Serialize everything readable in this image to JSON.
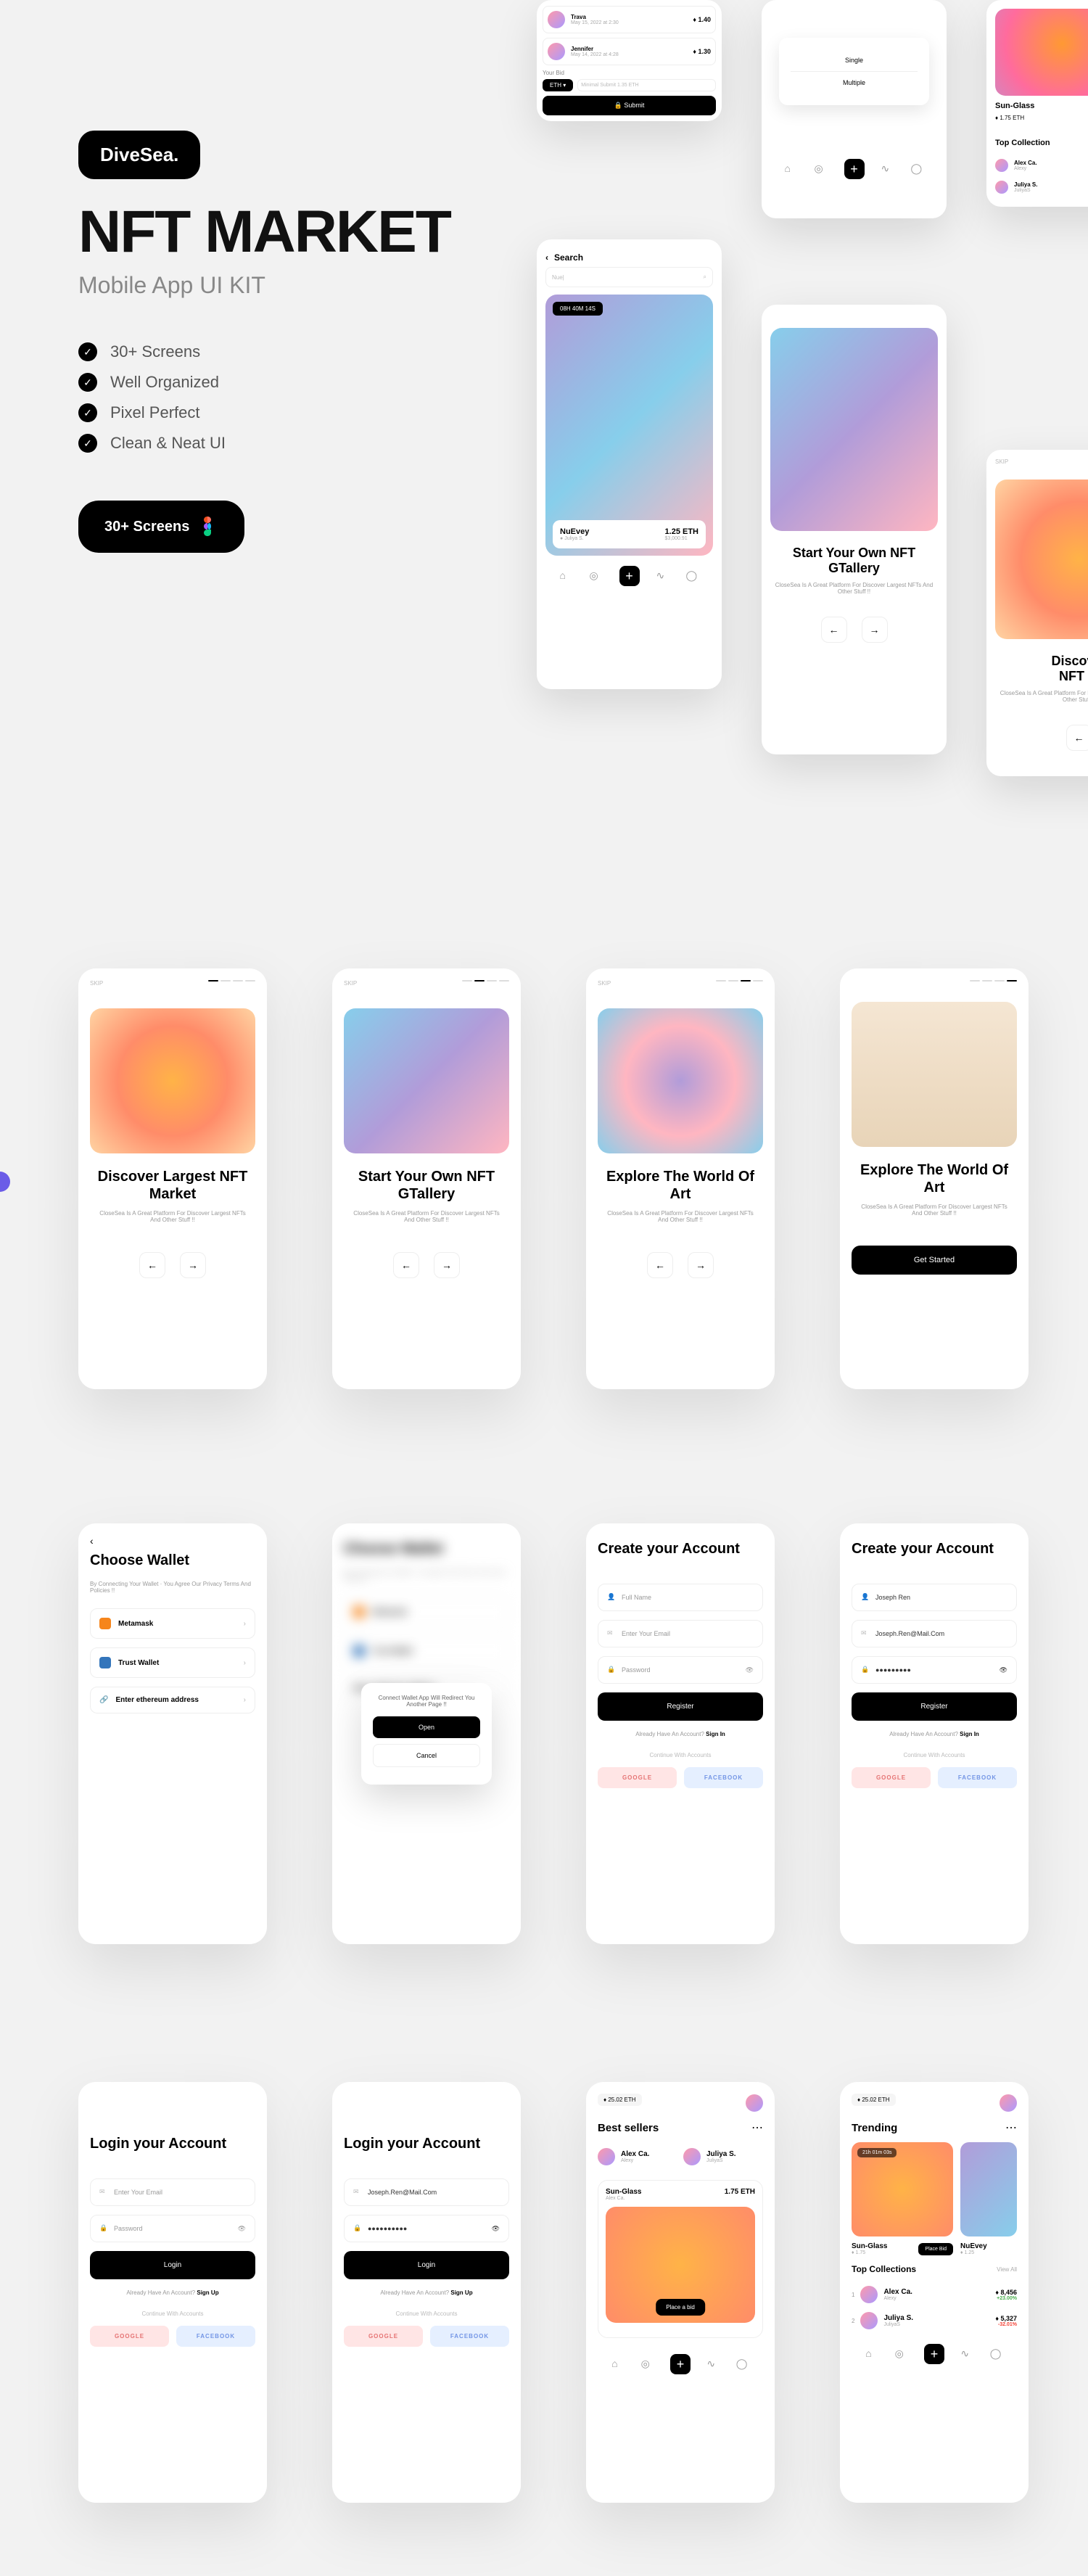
{
  "hero": {
    "logo": "DiveSea.",
    "title": "NFT MARKET",
    "subtitle": "Mobile App UI KIT",
    "features": [
      "30+ Screens",
      "Well Organized",
      "Pixel Perfect",
      "Clean & Neat UI"
    ],
    "cta": "30+ Screens"
  },
  "bids": [
    {
      "name": "Trava",
      "date": "May 15, 2022 at 2:30",
      "value": "1.40"
    },
    {
      "name": "Jennifer",
      "date": "May 14, 2022 at 4:28",
      "value": "1.30"
    }
  ],
  "bid_section": {
    "label": "Your Bid",
    "currency": "ETH ▾",
    "placeholder": "Minimal Submit 1.35 ETH",
    "submit": "Submit"
  },
  "modal": {
    "opt1": "Single",
    "opt2": "Multiple"
  },
  "search": {
    "label": "Search",
    "input": "Nue|"
  },
  "nft": {
    "timer": "08H  40M  14S",
    "name": "NuEvey",
    "by": "Juliya S.",
    "price": "1.25 ETH",
    "usd": "$3,000.91"
  },
  "onboard": [
    {
      "title": "Discover Largest NFT Market",
      "desc": "CloseSea Is A Great Platform For Discover Largest NFTs And Other Stuff !!"
    },
    {
      "title": "Start Your Own NFT GTallery",
      "desc": "CloseSea Is A Great Platform For Discover Largest NFTs And Other Stuff !!"
    },
    {
      "title": "Explore The World Of Art",
      "desc": "CloseSea Is A Great Platform For Discover Largest NFTs And Other Stuff !!"
    },
    {
      "title": "Explore The World Of Art",
      "desc": "CloseSea Is A Great Platform For Discover Largest NFTs And Other Stuff !!",
      "btn": "Get Started"
    }
  ],
  "skip": "SKIP",
  "wallet": {
    "title": "Choose Wallet",
    "desc": "By Connecting Your Wallet · You Agree Our Privacy Terms And Policies !!",
    "options": [
      "Metamask",
      "Trust Wallet",
      "Enter ethereum address"
    ],
    "popup": {
      "text": "Connect Wallet App Will Redirect You Another Page !!",
      "open": "Open",
      "cancel": "Cancel"
    }
  },
  "register": {
    "title": "Create your Account",
    "fields": {
      "name": "Full Name",
      "email": "Enter Your Email",
      "password": "Password"
    },
    "filled": {
      "name": "Joseph Ren",
      "email": "Joseph.Ren@Mail.Com",
      "password": "●●●●●●●●●"
    },
    "btn": "Register",
    "signin": "Already Have An Account? ",
    "signin_link": "Sign In",
    "continue": "Continue With Accounts",
    "google": "GOOGLE",
    "facebook": "FACEBOOK"
  },
  "login": {
    "title": "Login your Account",
    "email": "Enter Your Email",
    "password": "Password",
    "filled_email": "Joseph.Ren@Mail.Com",
    "filled_pw": "●●●●●●●●●●",
    "btn": "Login",
    "signup": "Already Have An Account? ",
    "signup_link": "Sign Up"
  },
  "home": {
    "eth": "25.02 ETH",
    "best_sellers": "Best sellers",
    "sellers": [
      {
        "name": "Alex Ca.",
        "handle": "Alexy"
      },
      {
        "name": "Juliya S.",
        "handle": "JuliyaS"
      }
    ],
    "nft_name": "Sun-Glass",
    "nft_by": "Alex Ca.",
    "nft_price": "1.75 ETH",
    "place_bid": "Place a bid",
    "trending": "Trending",
    "trend_badge": "21h 01m 03s",
    "trend_name": "Sun-Glass",
    "trend_price": "1.75",
    "trend2_name": "NuEvey",
    "trend2_price": "1.25",
    "top_coll": "Top Collections",
    "view_all": "View All",
    "collections": [
      {
        "name": "Alex Ca.",
        "handle": "Alexy",
        "value": "8,456",
        "change": "+23.00%"
      },
      {
        "name": "Juliya S.",
        "handle": "JuliyaS",
        "value": "5,327",
        "change": "-32.01%"
      }
    ]
  }
}
